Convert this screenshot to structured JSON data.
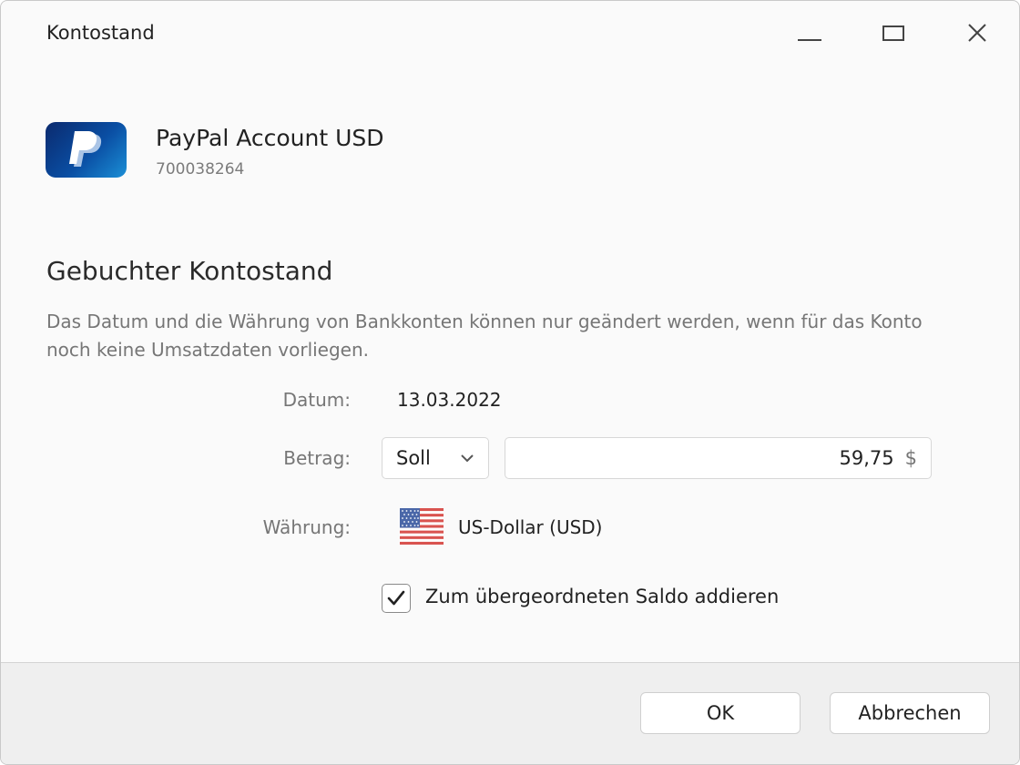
{
  "window": {
    "title": "Kontostand"
  },
  "account": {
    "name": "PayPal Account USD",
    "number": "700038264",
    "logo_icon": "paypal-logo"
  },
  "section": {
    "title": "Gebuchter Kontostand",
    "description": "Das Datum und die Währung von Bankkonten können nur geändert werden, wenn für das Konto noch keine Umsatzdaten vorliegen."
  },
  "form": {
    "date_label": "Datum:",
    "date_value": "13.03.2022",
    "amount_label": "Betrag:",
    "type_selected": "Soll",
    "amount_value": "59,75",
    "amount_currency_symbol": "$",
    "currency_label": "Währung:",
    "currency_value": "US-Dollar (USD)",
    "currency_flag_icon": "us-flag-icon",
    "checkbox_label": "Zum übergeordneten Saldo addieren",
    "checkbox_checked": true
  },
  "buttons": {
    "ok": "OK",
    "cancel": "Abbrechen"
  },
  "colors": {
    "accent_blue": "#0a4ea3",
    "paypal_light": "#1b8fd6",
    "footer_bg": "#efefef"
  }
}
